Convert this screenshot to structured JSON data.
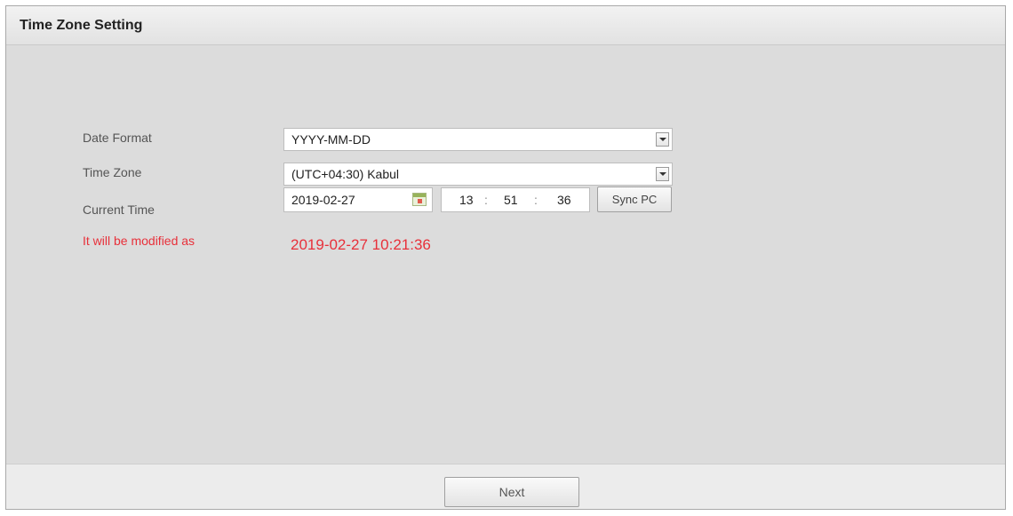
{
  "window": {
    "title": "Time Zone Setting"
  },
  "form": {
    "date_format": {
      "label": "Date Format",
      "value": "YYYY-MM-DD"
    },
    "time_zone": {
      "label": "Time Zone",
      "value": "(UTC+04:30) Kabul"
    },
    "current_time": {
      "label": "Current Time",
      "date": "2019-02-27",
      "hour": "13",
      "minute": "51",
      "second": "36",
      "separator": ":",
      "sync_label": "Sync PC"
    },
    "modified": {
      "label": "It will be modified as",
      "value": "2019-02-27 10:21:36"
    }
  },
  "footer": {
    "next_label": "Next"
  },
  "icons": {
    "dropdown": "chevron-down-icon",
    "calendar": "calendar-icon"
  },
  "colors": {
    "warning_text": "#e8303a",
    "panel_bg": "#dcdcdc"
  }
}
